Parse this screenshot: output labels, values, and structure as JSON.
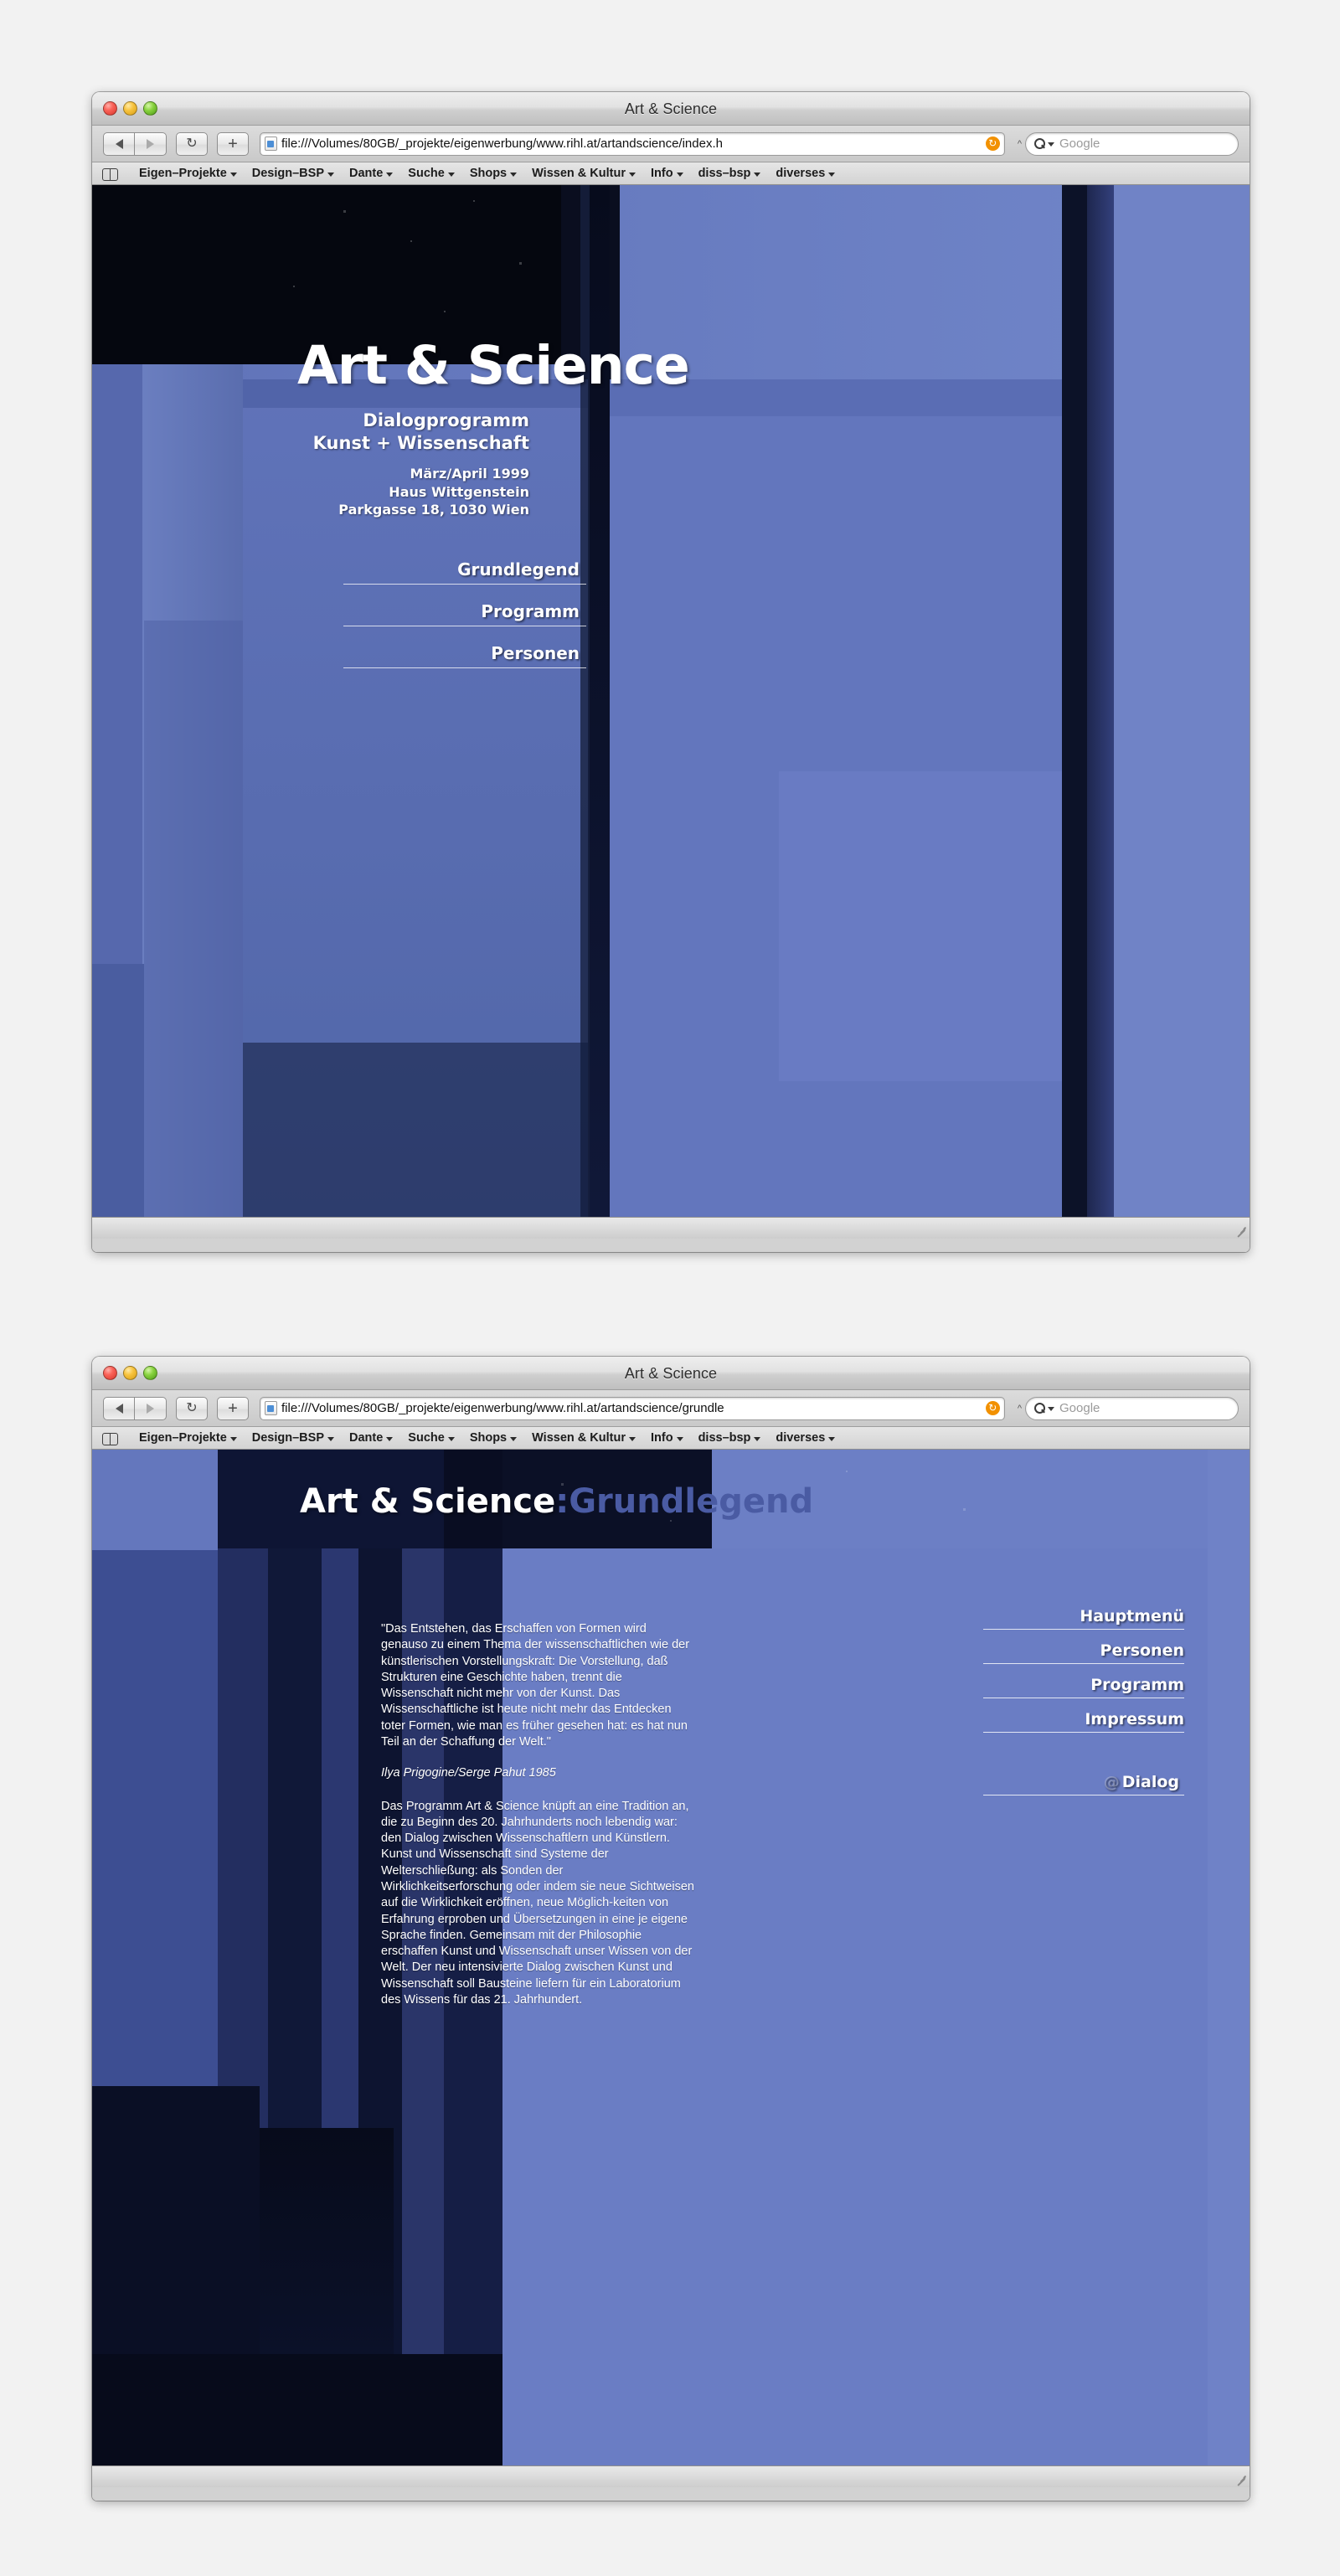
{
  "window1": {
    "title": "Art & Science",
    "traffic_lights": [
      "close",
      "minimize",
      "zoom"
    ],
    "toolbar": {
      "back_label": "◀",
      "forward_label": "▶",
      "reload_label": "↻",
      "add_label": "+",
      "url": "file:///Volumes/80GB/_projekte/eigenwerbung/www.rihl.at/artandscience/index.h",
      "stop_label": "↻",
      "search_placeholder": "Google"
    },
    "bookmarks": [
      {
        "label": "Eigen–Projekte",
        "has_menu": true
      },
      {
        "label": "Design–BSP",
        "has_menu": true
      },
      {
        "label": "Dante",
        "has_menu": true
      },
      {
        "label": "Suche",
        "has_menu": true
      },
      {
        "label": "Shops",
        "has_menu": true
      },
      {
        "label": "Wissen & Kultur",
        "has_menu": true
      },
      {
        "label": "Info",
        "has_menu": true
      },
      {
        "label": "diss–bsp",
        "has_menu": true
      },
      {
        "label": "diverses",
        "has_menu": true
      }
    ],
    "page": {
      "hero_title": "Art & Science",
      "subtitle_line1": "Dialogprogramm",
      "subtitle_line2": "Kunst + Wissenschaft",
      "info_line1": "März/April 1999",
      "info_line2": "Haus Wittgenstein",
      "info_line3": "Parkgasse 18, 1030 Wien",
      "nav": [
        {
          "label": "Grundlegend"
        },
        {
          "label": "Programm"
        },
        {
          "label": "Personen"
        }
      ]
    }
  },
  "window2": {
    "title": "Art & Science",
    "toolbar": {
      "back_label": "◀",
      "forward_label": "▶",
      "reload_label": "↻",
      "add_label": "+",
      "url": "file:///Volumes/80GB/_projekte/eigenwerbung/www.rihl.at/artandscience/grundle",
      "stop_label": "↻",
      "search_placeholder": "Google"
    },
    "bookmarks": [
      {
        "label": "Eigen–Projekte",
        "has_menu": true
      },
      {
        "label": "Design–BSP",
        "has_menu": true
      },
      {
        "label": "Dante",
        "has_menu": true
      },
      {
        "label": "Suche",
        "has_menu": true
      },
      {
        "label": "Shops",
        "has_menu": true
      },
      {
        "label": "Wissen & Kultur",
        "has_menu": true
      },
      {
        "label": "Info",
        "has_menu": true
      },
      {
        "label": "diss–bsp",
        "has_menu": true
      },
      {
        "label": "diverses",
        "has_menu": true
      }
    ],
    "page": {
      "header_white": "Art & Science",
      "header_dim": ":Grundlegend",
      "quote": "\"Das Entstehen, das Erschaffen von Formen wird genauso zu einem Thema der wissenschaftlichen wie der künstlerischen Vorstellungskraft: Die Vorstellung, daß Strukturen eine Geschichte haben, trennt die Wissenschaft nicht mehr von der Kunst. Das Wissenschaftliche ist heute nicht mehr das Entdecken toter Formen, wie man es früher gesehen hat: es hat nun Teil an der Schaffung der Welt.\"",
      "citation": "Ilya Prigogine/Serge Pahut 1985",
      "paragraph": "Das Programm Art & Science knüpft an eine Tradition an, die zu Beginn des 20. Jahrhunderts noch lebendig war: den Dialog zwischen Wissenschaftlern und Künstlern. Kunst und Wissenschaft sind Systeme der Welterschließung: als Sonden der Wirklichkeitserforschung oder indem sie neue Sichtweisen auf die Wirklichkeit eröffnen, neue Möglich-keiten von Erfahrung erproben und Übersetzungen in eine je eigene Sprache finden. Gemeinsam mit der Philosophie erschaffen Kunst und Wissenschaft unser Wissen von der Welt. Der neu intensivierte Dialog zwischen Kunst und Wissenschaft soll Bausteine liefern für ein Laboratorium des Wissens für das 21. Jahrhundert.",
      "nav": [
        {
          "label": "Hauptmenü"
        },
        {
          "label": "Personen"
        },
        {
          "label": "Programm"
        },
        {
          "label": "Impressum"
        }
      ],
      "dialog_at": "@",
      "dialog_label": "Dialog"
    }
  },
  "colors": {
    "page_background": "#f2f2f2",
    "site_blue": "#6d7fc2",
    "site_dark": "#0b0f22",
    "accent_dim_blue": "#4a5ba3",
    "reload_orange": "#f29100"
  }
}
